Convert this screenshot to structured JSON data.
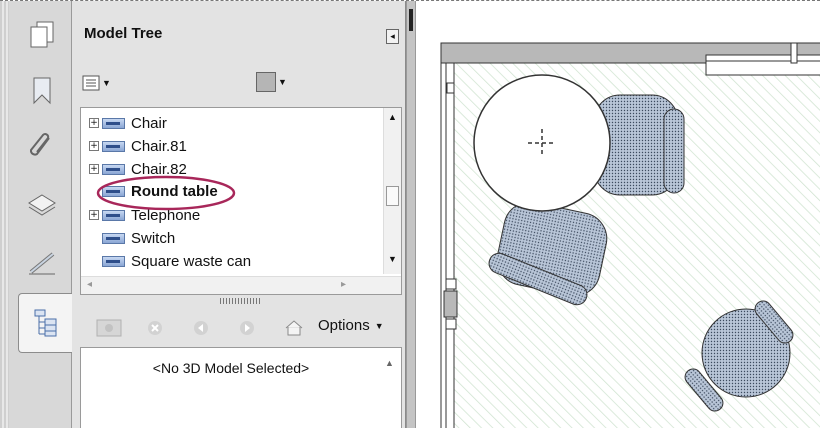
{
  "panel": {
    "title": "Model Tree",
    "collapse_glyph": "◂",
    "tree_items": [
      {
        "label": "Chair",
        "expandable": true,
        "bold": false
      },
      {
        "label": "Chair.81",
        "expandable": true,
        "bold": false
      },
      {
        "label": "Chair.82",
        "expandable": true,
        "bold": false
      },
      {
        "label": "Round table",
        "expandable": false,
        "bold": true
      },
      {
        "label": "Telephone",
        "expandable": true,
        "bold": false
      },
      {
        "label": "Switch",
        "expandable": false,
        "bold": false
      },
      {
        "label": "Square waste can",
        "expandable": false,
        "bold": false
      }
    ],
    "options_label": "Options",
    "status_text": "<No 3D Model Selected>"
  },
  "rail": {
    "icons": [
      "pages-icon",
      "bookmark-icon",
      "attachment-icon",
      "layers-icon",
      "signatures-icon",
      "model-tree-icon"
    ],
    "active": "model-tree-icon"
  },
  "colors": {
    "highlight_ring": "#a8275a",
    "furniture_fill": "#b9c6d8",
    "floor_hatch": "#cfe3d0"
  }
}
